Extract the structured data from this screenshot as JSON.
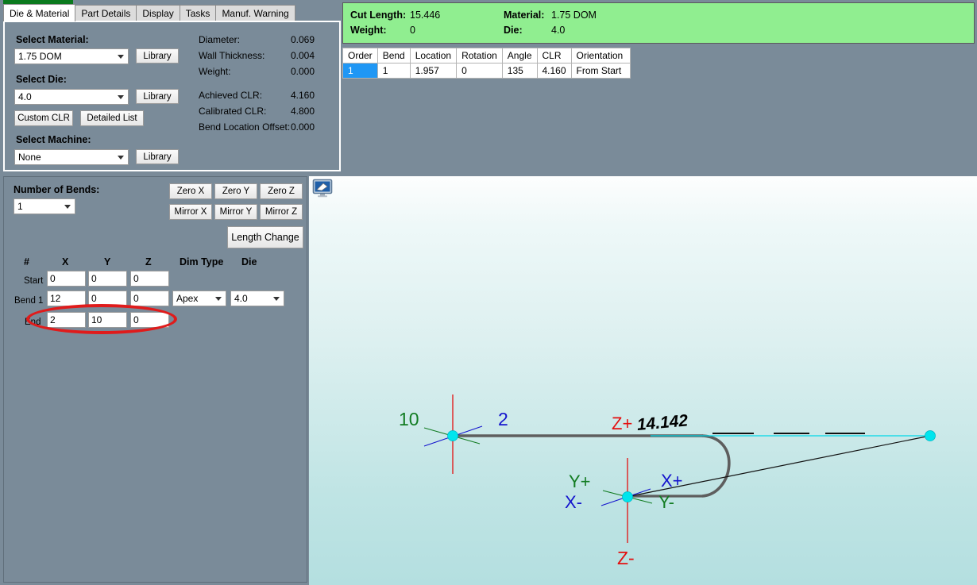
{
  "tabs": [
    {
      "label": "Die & Material",
      "active": true
    },
    {
      "label": "Part Details",
      "active": false
    },
    {
      "label": "Display",
      "active": false
    },
    {
      "label": "Tasks",
      "active": false
    },
    {
      "label": "Manuf. Warning",
      "active": false
    }
  ],
  "die_material": {
    "material_label": "Select Material:",
    "material_value": "1.75 DOM",
    "material_library_btn": "Library",
    "die_label": "Select Die:",
    "die_value": "4.0",
    "die_library_btn": "Library",
    "custom_clr_btn": "Custom CLR",
    "detailed_list_btn": "Detailed List",
    "machine_label": "Select Machine:",
    "machine_value": "None",
    "machine_library_btn": "Library",
    "stats": [
      {
        "label": "Diameter:",
        "value": "0.069"
      },
      {
        "label": "Wall Thickness:",
        "value": "0.004"
      },
      {
        "label": "Weight:",
        "value": "0.000"
      },
      {
        "label": "Achieved CLR:",
        "value": "4.160"
      },
      {
        "label": "Calibrated CLR:",
        "value": "4.800"
      },
      {
        "label": "Bend Location Offset:",
        "value": "0.000"
      }
    ]
  },
  "summary": {
    "cut_length_label": "Cut Length:",
    "cut_length_value": "15.446",
    "weight_label": "Weight:",
    "weight_value": "0",
    "material_label": "Material:",
    "material_value": "1.75 DOM",
    "die_label": "Die:",
    "die_value": "4.0",
    "background_color": "#90ee90"
  },
  "bend_table": {
    "headers": [
      "Order",
      "Bend",
      "Location",
      "Rotation",
      "Angle",
      "CLR",
      "Orientation"
    ],
    "rows": [
      {
        "order": "1",
        "bend": "1",
        "location": "1.957",
        "rotation": "0",
        "angle": "135",
        "clr": "4.160",
        "orientation": "From Start",
        "selected": true
      }
    ],
    "selection_color": "#1f97f5"
  },
  "bends_panel": {
    "number_of_bends_label": "Number of Bends:",
    "number_of_bends_value": "1",
    "zero_buttons": [
      "Zero X",
      "Zero Y",
      "Zero Z"
    ],
    "mirror_buttons": [
      "Mirror X",
      "Mirror Y",
      "Mirror Z"
    ],
    "length_change_btn": "Length Change",
    "grid_headers": [
      "#",
      "X",
      "Y",
      "Z",
      "Dim Type",
      "Die"
    ],
    "rows": [
      {
        "name": "Start",
        "x": "0",
        "y": "0",
        "z": "0",
        "dim_type": null,
        "die": null
      },
      {
        "name": "Bend 1",
        "x": "12",
        "y": "0",
        "z": "0",
        "dim_type": "Apex",
        "die": "4.0"
      },
      {
        "name": "End",
        "x": "2",
        "y": "10",
        "z": "0",
        "dim_type": null,
        "die": null
      }
    ],
    "annotation": {
      "shape": "ellipse",
      "color": "#e01b1b",
      "target_row": "End"
    }
  },
  "viewport": {
    "display_icon": "monitor-icon",
    "labels": [
      {
        "text": "10",
        "color": "#127c22",
        "name": "segment-length-10"
      },
      {
        "text": "2",
        "color": "#1414cd",
        "name": "segment-length-2"
      },
      {
        "text": "14.142",
        "color": "#000000",
        "name": "dimension-14-142"
      },
      {
        "text": "Z+",
        "color": "#e31010",
        "name": "axis-z-plus"
      },
      {
        "text": "Z-",
        "color": "#e31010",
        "name": "axis-z-minus"
      },
      {
        "text": "Y+",
        "color": "#127c22",
        "name": "axis-y-plus"
      },
      {
        "text": "Y-",
        "color": "#127c22",
        "name": "axis-y-minus"
      },
      {
        "text": "X+",
        "color": "#1414cd",
        "name": "axis-x-plus"
      },
      {
        "text": "X-",
        "color": "#1414cd",
        "name": "axis-x-minus"
      }
    ],
    "background_top": "#fdfefe",
    "background_bottom": "#b4dfe0"
  }
}
